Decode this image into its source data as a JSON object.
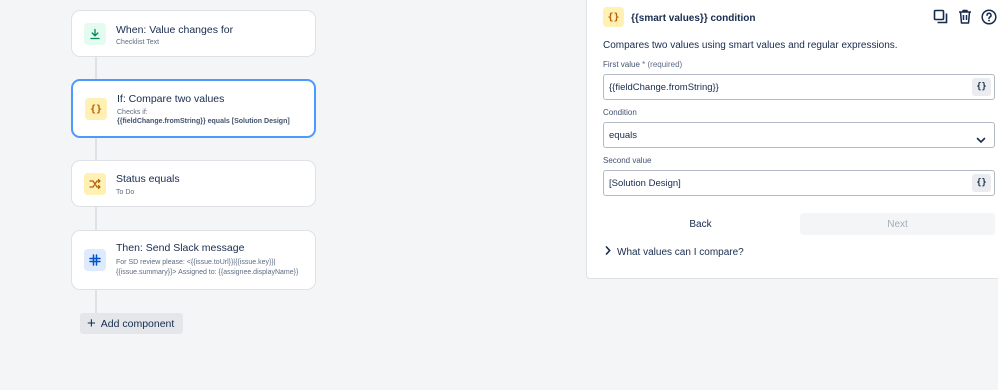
{
  "flow": {
    "cards": [
      {
        "title": "When: Value changes for",
        "sub": "Checklist Text",
        "icon": "download-icon"
      },
      {
        "title": "If: Compare two values",
        "sub1": "Checks if:",
        "sub2": "{{fieldChange.fromString}} equals [Solution Design]",
        "icon": "smart-value-braces-icon"
      },
      {
        "title": "Status equals",
        "sub": "To Do",
        "icon": "shuffle-icon"
      },
      {
        "title": "Then: Send Slack message",
        "sub1": "For SD review please: <{{issue.toUrl}}|{{issue.key}}|",
        "sub2": "{{issue.summary}}> Assigned to: {{assignee.displayName}}",
        "icon": "slack-icon"
      }
    ],
    "add_component": "Add component"
  },
  "panel": {
    "icon_glyph": "{}",
    "title": "{{smart values}} condition",
    "description": "Compares two values using smart values and regular expressions.",
    "first_value_label": "First value",
    "required_mark": "*",
    "required_text": "(required)",
    "first_value": "{{fieldChange.fromString}}",
    "condition_label": "Condition",
    "condition_value": "equals",
    "second_value_label": "Second value",
    "second_value": "[Solution Design]",
    "smart_value_glyph": "{}",
    "back": "Back",
    "next": "Next",
    "help_toggle": "What values can I compare?"
  },
  "colors": {
    "accent_selected": "#4c9aff",
    "trigger_icon_bg": "#e3fcef",
    "condition_icon_bg": "#fff0b3",
    "branch_icon_bg": "#fff0b3",
    "action_icon_bg": "#deebff"
  }
}
